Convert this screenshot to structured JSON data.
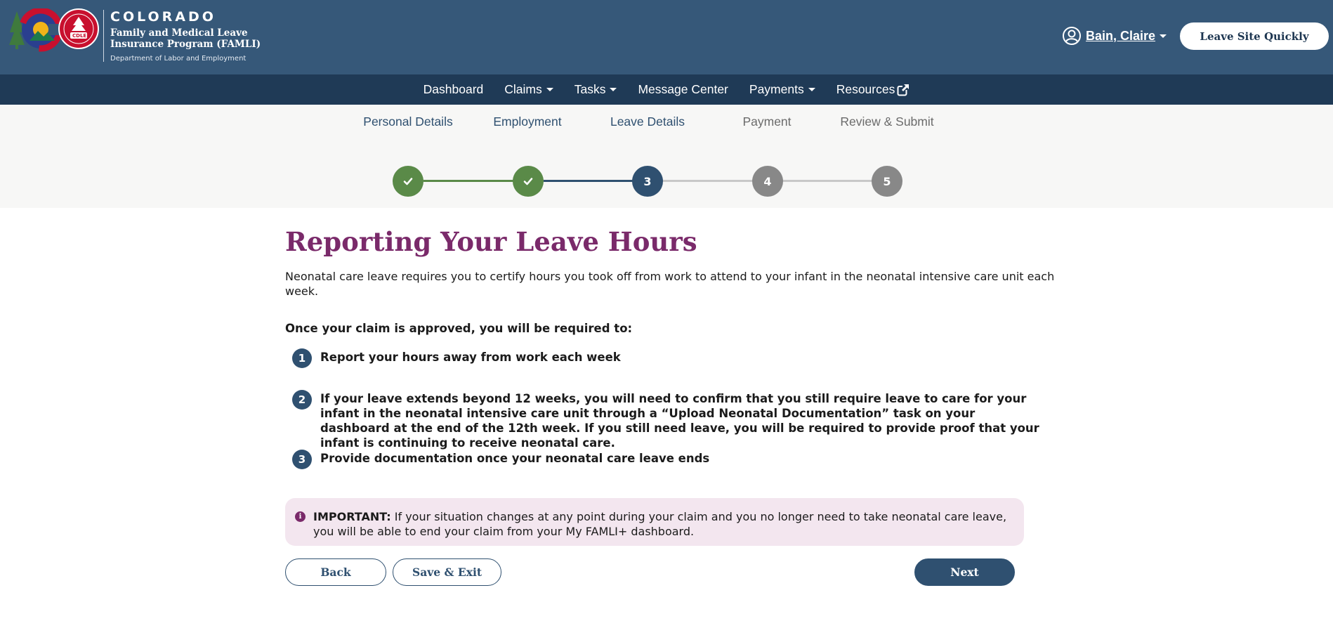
{
  "header": {
    "brand_title": "COLORADO",
    "brand_subtitle": "Family and Medical Leave Insurance Program (FAMLI)",
    "department": "Department of Labor and Employment",
    "logo_badge_text": "CDLE",
    "user_name": "Bain, Claire",
    "leave_site_label": "Leave Site Quickly"
  },
  "nav": {
    "items": [
      {
        "label": "Dashboard",
        "dropdown": false
      },
      {
        "label": "Claims",
        "dropdown": true
      },
      {
        "label": "Tasks",
        "dropdown": true
      },
      {
        "label": "Message Center",
        "dropdown": false
      },
      {
        "label": "Payments",
        "dropdown": true
      },
      {
        "label": "Resources",
        "dropdown": false,
        "icon": "external-link-icon"
      }
    ]
  },
  "stepper": {
    "steps": [
      {
        "label": "Personal Details",
        "number": "1",
        "status": "done"
      },
      {
        "label": "Employment",
        "number": "2",
        "status": "done"
      },
      {
        "label": "Leave Details",
        "number": "3",
        "status": "active"
      },
      {
        "label": "Payment",
        "number": "4",
        "status": "future"
      },
      {
        "label": "Review & Submit",
        "number": "5",
        "status": "future"
      }
    ],
    "colors": {
      "done": "#5a8a48",
      "active": "#2f5070",
      "future": "#888888",
      "future_line": "#c8c8c8"
    }
  },
  "main": {
    "title": "Reporting Your Leave Hours",
    "intro": "Neonatal care leave requires you to certify hours you took off from work to attend to your infant in the neonatal intensive care unit each week.",
    "once_text": "Once your claim is approved, you will be required to:",
    "requirements": [
      {
        "number": "1",
        "text": "Report your hours away from work each week"
      },
      {
        "number": "2",
        "text": "If your leave extends beyond 12 weeks, you will need to confirm that you still require leave to care for your infant in the neonatal intensive care unit through a “Upload Neonatal Documentation” task on your dashboard at the end of the 12th week. If you still need leave, you will be required to provide proof that your infant is continuing to receive neonatal care."
      },
      {
        "number": "3",
        "text": "Provide documentation once your neonatal care leave ends"
      }
    ],
    "alert": {
      "label": "IMPORTANT:",
      "text": " If your situation changes at any point during your claim and you no longer need to take neonatal care leave, you will be able to end your claim from your My FAMLI+ dashboard."
    }
  },
  "actions": {
    "back_label": "Back",
    "save_exit_label": "Save & Exit",
    "next_label": "Next"
  },
  "colors": {
    "header_bg": "#365879",
    "nav_bg": "#1f3a56",
    "title": "#7a2a6a",
    "primary": "#2f5070",
    "alert_bg": "#f3e6ef"
  }
}
